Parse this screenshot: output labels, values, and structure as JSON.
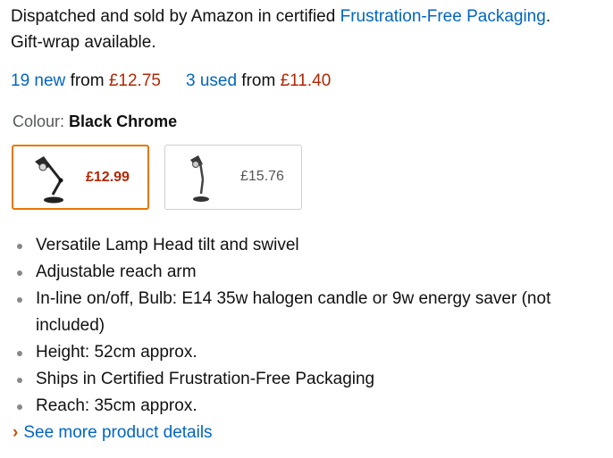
{
  "dispatch": {
    "text": "Dispatched and sold by Amazon in certified ",
    "link": "Frustration-Free Packaging",
    "suffix": ".",
    "line2": "Gift-wrap available."
  },
  "offers": {
    "new_link": "19 new",
    "new_from": "from",
    "new_price": "£12.75",
    "used_link": "3 used",
    "used_from": "from",
    "used_price": "£11.40"
  },
  "colour": {
    "label": "Colour:",
    "value": "Black Chrome"
  },
  "swatches": [
    {
      "price": "£12.99",
      "selected": true
    },
    {
      "price": "£15.76",
      "selected": false
    }
  ],
  "bullets": [
    "Versatile Lamp Head tilt and swivel",
    "Adjustable reach arm",
    "In-line on/off, Bulb: E14 35w halogen candle or 9w energy saver (not included)",
    "Height: 52cm approx.",
    "Ships in Certified Frustration-Free Packaging",
    "Reach: 35cm approx."
  ],
  "see_more": {
    "chevron": "›",
    "label": "See more product details"
  },
  "colors": {
    "link": "#0066c0",
    "price": "#B12704",
    "selected_border": "#e77600"
  }
}
